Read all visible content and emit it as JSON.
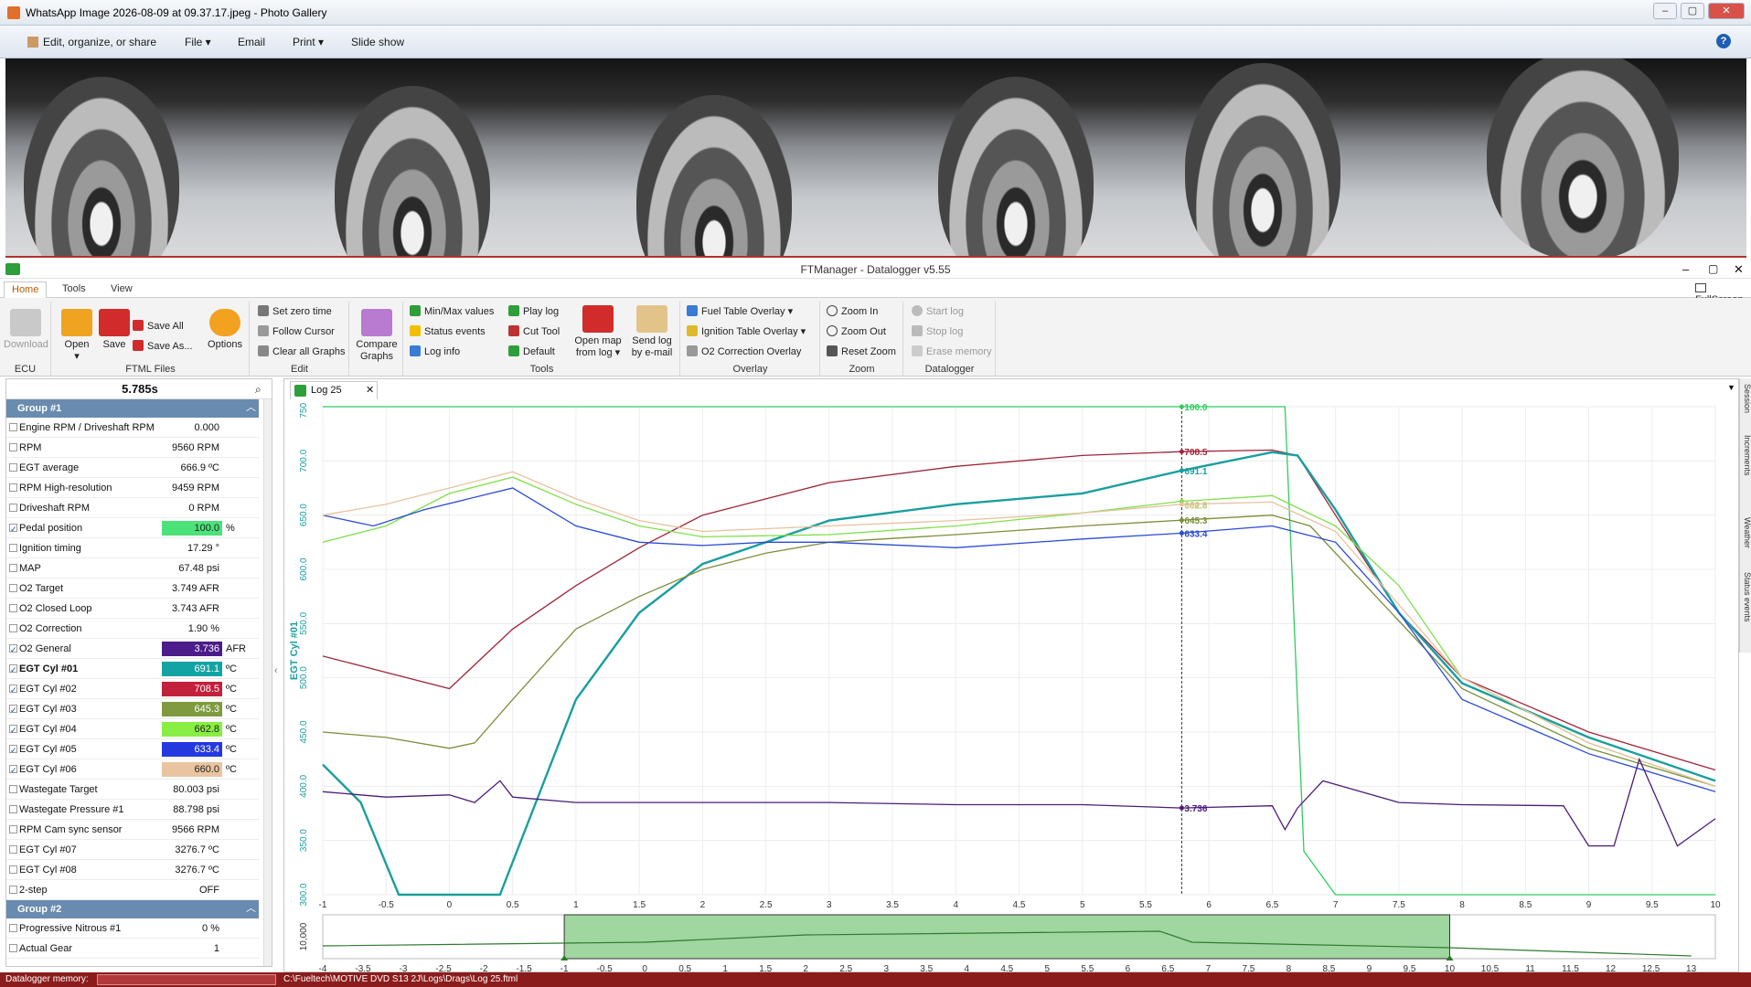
{
  "photo_window": {
    "title": "WhatsApp Image 2026-08-09 at 09.37.17.jpeg - Photo Gallery",
    "menu": [
      "Edit, organize, or share",
      "File",
      "Email",
      "Print",
      "Slide show"
    ]
  },
  "app": {
    "title": "FTManager - Datalogger v5.55",
    "tabs": [
      "Home",
      "Tools",
      "View"
    ],
    "fullscreen": "FullScreen"
  },
  "ribbon": {
    "ecu": {
      "label": "ECU",
      "download": "Download"
    },
    "files": {
      "label": "FTML Files",
      "open": "Open",
      "save": "Save",
      "save_all": "Save All",
      "save_as": "Save As...",
      "options": "Options"
    },
    "edit": {
      "label": "Edit",
      "set_zero": "Set zero time",
      "follow": "Follow Cursor",
      "clear": "Clear all Graphs",
      "compare": "Compare Graphs"
    },
    "tools": {
      "label": "Tools",
      "minmax": "Min/Max values",
      "status": "Status events",
      "loginfo": "Log info",
      "play": "Play log",
      "cut": "Cut Tool",
      "default": "Default",
      "openmap": "Open map from log",
      "send": "Send log by e-mail"
    },
    "overlay": {
      "label": "Overlay",
      "fuel": "Fuel Table Overlay",
      "ign": "Ignition Table Overlay",
      "o2": "O2 Correction Overlay"
    },
    "zoom": {
      "label": "Zoom",
      "in": "Zoom In",
      "out": "Zoom Out",
      "reset": "Reset Zoom"
    },
    "datalogger": {
      "label": "Datalogger",
      "start": "Start log",
      "stop": "Stop log",
      "erase": "Erase memory"
    }
  },
  "left": {
    "time": "5.785s",
    "group1": "Group #1",
    "group2": "Group #2",
    "rows": [
      {
        "name": "Engine RPM / Driveshaft RPM",
        "value": "0.000",
        "unit": ""
      },
      {
        "name": "RPM",
        "value": "9560 RPM",
        "unit": ""
      },
      {
        "name": "EGT average",
        "value": "666.9 ºC",
        "unit": ""
      },
      {
        "name": "RPM High-resolution",
        "value": "9459 RPM",
        "unit": ""
      },
      {
        "name": "Driveshaft RPM",
        "value": "0 RPM",
        "unit": ""
      },
      {
        "name": "Pedal position",
        "value": "100.0",
        "unit": "%"
      },
      {
        "name": "Ignition timing",
        "value": "17.29 °",
        "unit": ""
      },
      {
        "name": "MAP",
        "value": "67.48 psi",
        "unit": ""
      },
      {
        "name": "O2 Target",
        "value": "3.749 AFR",
        "unit": ""
      },
      {
        "name": "O2 Closed Loop",
        "value": "3.743 AFR",
        "unit": ""
      },
      {
        "name": "O2 Correction",
        "value": "1.90 %",
        "unit": ""
      },
      {
        "name": "O2 General",
        "value": "3.736",
        "unit": "AFR"
      },
      {
        "name": "EGT Cyl #01",
        "value": "691.1",
        "unit": "ºC"
      },
      {
        "name": "EGT Cyl #02",
        "value": "708.5",
        "unit": "ºC"
      },
      {
        "name": "EGT Cyl #03",
        "value": "645.3",
        "unit": "ºC"
      },
      {
        "name": "EGT Cyl #04",
        "value": "662.8",
        "unit": "ºC"
      },
      {
        "name": "EGT Cyl #05",
        "value": "633.4",
        "unit": "ºC"
      },
      {
        "name": "EGT Cyl #06",
        "value": "660.0",
        "unit": "ºC"
      },
      {
        "name": "Wastegate Target",
        "value": "80.003 psi",
        "unit": ""
      },
      {
        "name": "Wastegate Pressure #1",
        "value": "88.798 psi",
        "unit": ""
      },
      {
        "name": "RPM Cam sync sensor",
        "value": "9566 RPM",
        "unit": ""
      },
      {
        "name": "EGT Cyl #07",
        "value": "3276.7 ºC",
        "unit": ""
      },
      {
        "name": "EGT Cyl #08",
        "value": "3276.7 ºC",
        "unit": ""
      },
      {
        "name": "2-step",
        "value": "OFF",
        "unit": ""
      },
      {
        "name": "Progressive Nitrous #1",
        "value": "0 %",
        "unit": ""
      },
      {
        "name": "Actual Gear",
        "value": "1",
        "unit": ""
      }
    ]
  },
  "chart_tab": "Log 25",
  "side_tabs": [
    "Session",
    "Increments",
    "Weather",
    "Status events"
  ],
  "status": {
    "label": "Datalogger memory:",
    "path": "C:\\Fueltech\\MOTIVE DVD S13 2J\\Logs\\Drags\\Log 25.ftml"
  },
  "chart_data": {
    "type": "line",
    "ylabel": "EGT Cyl #01",
    "xlim": [
      -1,
      10
    ],
    "ylim": [
      300,
      750
    ],
    "x_ticks": [
      "-1",
      "-0.5",
      "0",
      "0.5",
      "1",
      "1.5",
      "2",
      "2.5",
      "3",
      "3.5",
      "4",
      "4.5",
      "5",
      "5.5",
      "6",
      "6.5",
      "7",
      "7.5",
      "8",
      "8.5",
      "9",
      "9.5",
      "10"
    ],
    "y_ticks": [
      "300.0",
      "350.0",
      "400.0",
      "450.0",
      "500.0",
      "550.0",
      "600.0",
      "650.0",
      "700.0",
      "750.0"
    ],
    "cursor_x": 5.785,
    "series": [
      {
        "color": "#2ecc5f",
        "label": "100.0",
        "x": [
          -1,
          6.45,
          6.6,
          6.75,
          7,
          10
        ],
        "y": [
          750,
          750,
          750,
          340,
          300,
          300
        ]
      },
      {
        "color": "#a0243a",
        "label": "708.5",
        "x": [
          -1,
          -0.5,
          0,
          0.5,
          1,
          1.5,
          2,
          2.5,
          3,
          4,
          5,
          5.785,
          6.5,
          6.7,
          7,
          7.5,
          8,
          9,
          10
        ],
        "y": [
          520,
          505,
          490,
          545,
          585,
          620,
          650,
          665,
          680,
          695,
          705,
          708.5,
          710,
          705,
          650,
          560,
          500,
          450,
          415
        ]
      },
      {
        "color": "#1a9e9e",
        "label": "691.1",
        "x": [
          -1,
          -0.7,
          -0.4,
          0.4,
          0.6,
          1,
          1.5,
          2,
          3,
          4,
          5,
          5.785,
          6.5,
          6.7,
          7,
          7.5,
          8,
          9,
          10
        ],
        "y": [
          420,
          385,
          300,
          300,
          360,
          480,
          560,
          605,
          645,
          660,
          670,
          691.1,
          708,
          705,
          655,
          560,
          495,
          445,
          405
        ]
      },
      {
        "color": "#7c8f3b",
        "label": "645.3",
        "x": [
          -1,
          -0.5,
          0,
          0.2,
          0.5,
          1,
          1.5,
          2,
          2.5,
          3,
          4,
          5,
          5.785,
          6.5,
          6.8,
          7.2,
          8,
          9,
          10
        ],
        "y": [
          450,
          445,
          435,
          440,
          480,
          545,
          575,
          600,
          615,
          625,
          632,
          640,
          645.3,
          650,
          640,
          590,
          490,
          435,
          400
        ]
      },
      {
        "color": "#7fe04a",
        "label": "662.8",
        "x": [
          -1,
          -0.5,
          0,
          0.5,
          1,
          1.5,
          2,
          3,
          4,
          5,
          5.785,
          6.5,
          7,
          7.5,
          8,
          9,
          10
        ],
        "y": [
          625,
          640,
          670,
          685,
          660,
          640,
          630,
          632,
          640,
          652,
          662.8,
          668,
          640,
          585,
          500,
          440,
          400
        ]
      },
      {
        "color": "#2a4ad8",
        "label": "633.4",
        "x": [
          -1,
          -0.6,
          -0.2,
          0.5,
          1,
          1.5,
          2,
          2.5,
          3,
          4,
          5,
          5.785,
          6.5,
          7,
          7.5,
          8,
          9,
          10
        ],
        "y": [
          650,
          640,
          655,
          675,
          640,
          625,
          622,
          625,
          625,
          620,
          628,
          633.4,
          640,
          625,
          560,
          480,
          430,
          395
        ]
      },
      {
        "color": "#e7c29f",
        "label": "660.0",
        "x": [
          -1,
          -0.5,
          0,
          0.5,
          1,
          1.5,
          2,
          3,
          4,
          5,
          5.785,
          6.5,
          7,
          8,
          9,
          10
        ],
        "y": [
          650,
          660,
          675,
          690,
          665,
          645,
          635,
          640,
          645,
          652,
          660,
          662,
          635,
          500,
          440,
          400
        ]
      },
      {
        "color": "#4b1c7a",
        "label": "3.736",
        "x": [
          -1,
          -0.5,
          0,
          0.2,
          0.4,
          0.5,
          1,
          2,
          3,
          4,
          5,
          5.785,
          6.5,
          6.6,
          6.7,
          6.9,
          7.2,
          7.5,
          8,
          8.8,
          9,
          9.2,
          9.4,
          9.7,
          10
        ],
        "y": [
          395,
          390,
          392,
          385,
          405,
          390,
          385,
          385,
          385,
          383,
          383,
          380,
          382,
          360,
          380,
          405,
          395,
          385,
          383,
          382,
          345,
          345,
          425,
          345,
          370
        ]
      }
    ],
    "overview": {
      "x_ticks": [
        "-4",
        "-3.5",
        "-3",
        "-2.5",
        "-2",
        "-1.5",
        "-1",
        "-0.5",
        "0",
        "0.5",
        "1",
        "1.5",
        "2",
        "2.5",
        "3",
        "3.5",
        "4",
        "4.5",
        "5",
        "5.5",
        "6",
        "6.5",
        "7",
        "7.5",
        "8",
        "8.5",
        "9",
        "9.5",
        "10",
        "10.5",
        "11",
        "11.5",
        "12",
        "12.5",
        "13"
      ],
      "ylabel": "10,000",
      "range": [
        -1,
        10
      ]
    }
  }
}
